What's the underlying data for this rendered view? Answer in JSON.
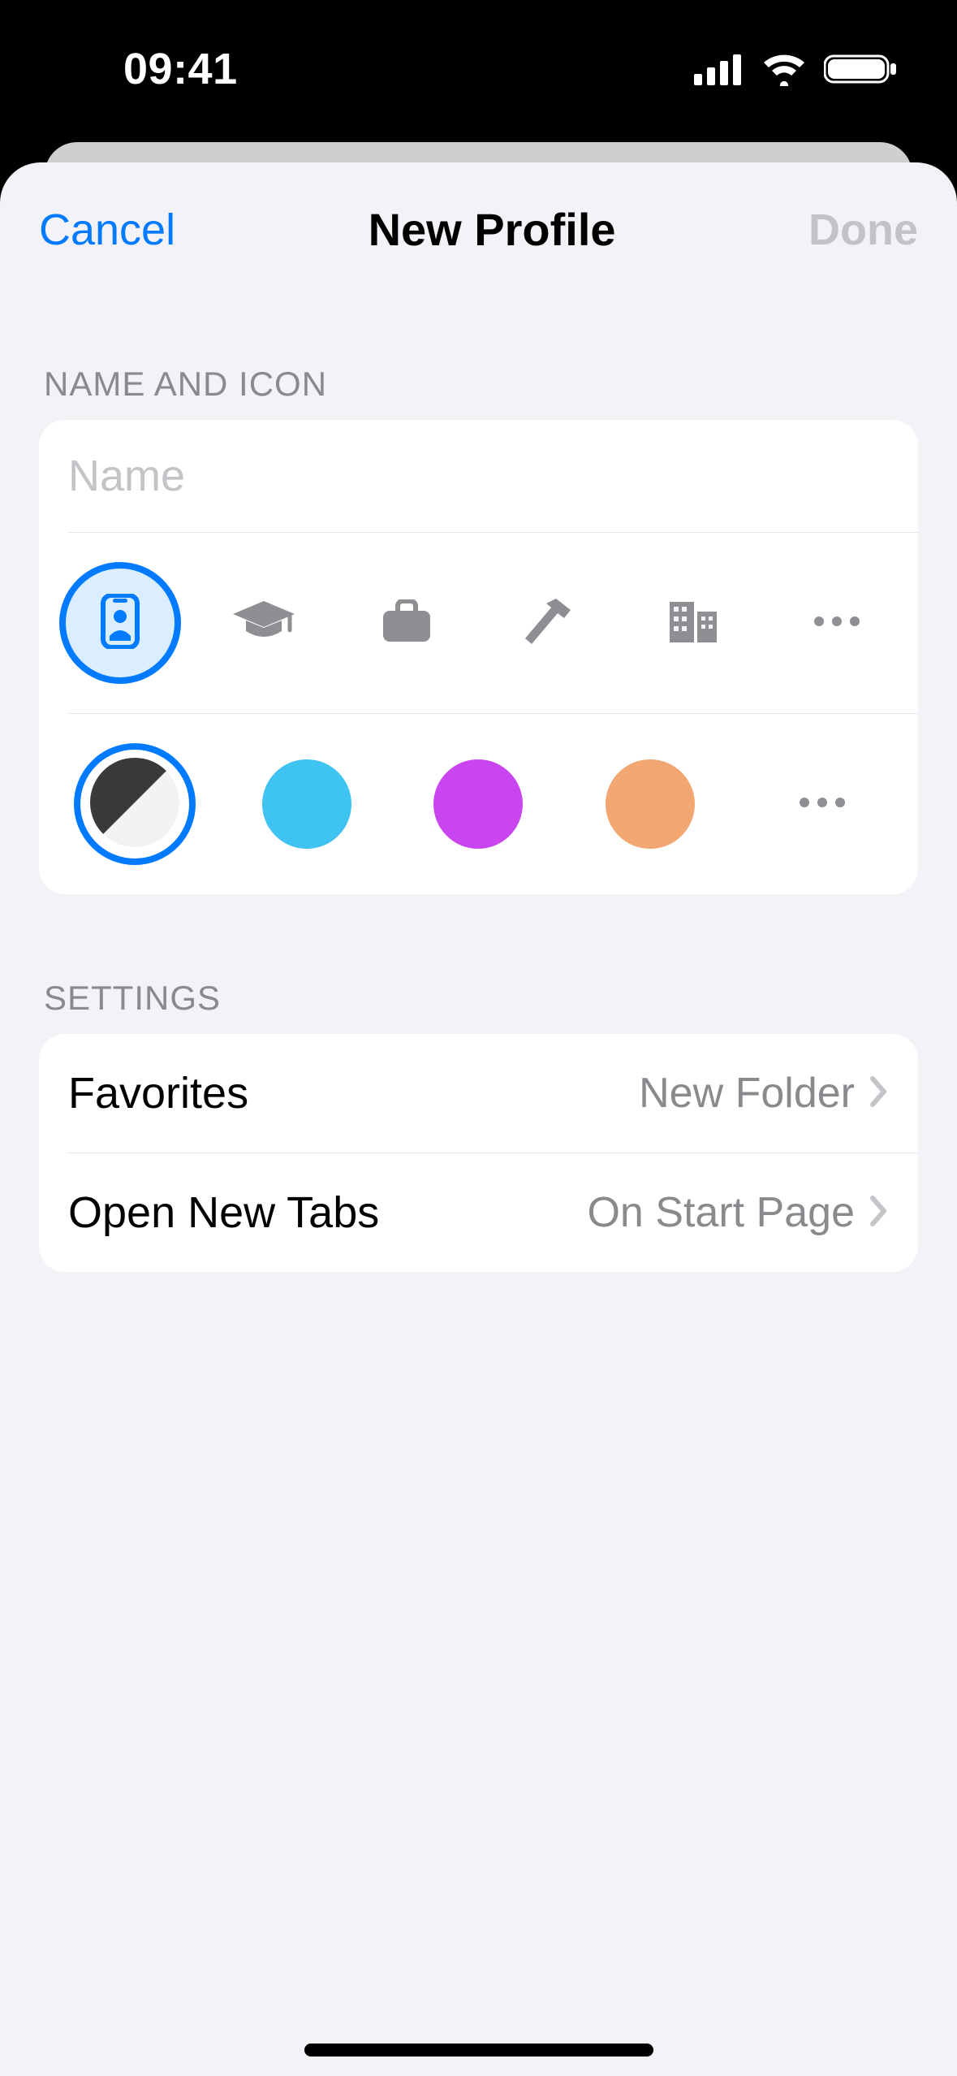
{
  "status": {
    "time": "09:41"
  },
  "nav": {
    "cancel": "Cancel",
    "title": "New Profile",
    "done": "Done"
  },
  "sections": {
    "name_icon_header": "NAME AND ICON",
    "settings_header": "SETTINGS"
  },
  "name_input": {
    "value": "",
    "placeholder": "Name"
  },
  "icons": [
    {
      "id": "id-card",
      "selected": true
    },
    {
      "id": "graduation",
      "selected": false
    },
    {
      "id": "briefcase",
      "selected": false
    },
    {
      "id": "hammer",
      "selected": false
    },
    {
      "id": "building",
      "selected": false
    },
    {
      "id": "more",
      "selected": false
    }
  ],
  "colors": [
    {
      "id": "two-tone",
      "hex": "#3a3a3c",
      "selected": true
    },
    {
      "id": "blue",
      "hex": "#3fc4f2",
      "selected": false
    },
    {
      "id": "purple",
      "hex": "#c945ef",
      "selected": false
    },
    {
      "id": "orange",
      "hex": "#f2a671",
      "selected": false
    },
    {
      "id": "more",
      "hex": "",
      "selected": false
    }
  ],
  "settings": {
    "favorites": {
      "label": "Favorites",
      "value": "New Folder"
    },
    "open_tabs": {
      "label": "Open New Tabs",
      "value": "On Start Page"
    }
  }
}
